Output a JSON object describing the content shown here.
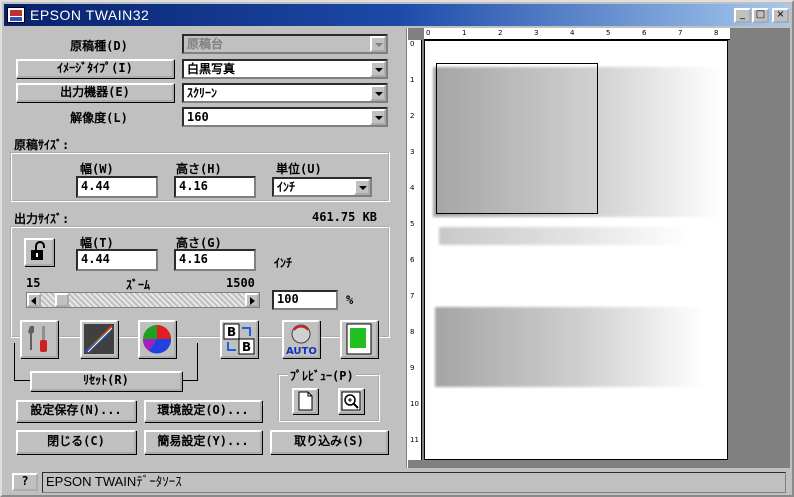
{
  "window": {
    "title": "EPSON TWAIN32",
    "minimize": "_",
    "maximize": "□",
    "close": "×"
  },
  "source_type": {
    "label": "原稿種(D)",
    "value": "原稿台"
  },
  "image_type": {
    "label": "ｲﾒｰｼﾞﾀｲﾌﾟ(I)",
    "value": "白黒写真"
  },
  "output_device": {
    "label": "出力機器(E)",
    "value": "ｽｸﾘｰﾝ"
  },
  "resolution": {
    "label": "解像度(L)",
    "value": "160"
  },
  "source_size": {
    "title": "原稿ｻｲｽﾞ:",
    "width_label": "幅(W)",
    "width_value": "4.44",
    "height_label": "高さ(H)",
    "height_value": "4.16",
    "unit_label": "単位(U)",
    "unit_value": "ｲﾝﾁ"
  },
  "output_size": {
    "title": "出力ｻｲｽﾞ:",
    "file_size": "461.75 KB",
    "width_label": "幅(T)",
    "width_value": "4.44",
    "height_label": "高さ(G)",
    "height_value": "4.16",
    "unit": "ｲﾝﾁ",
    "zoom_min": "15",
    "zoom_label": "ｽﾞｰﾑ",
    "zoom_max": "1500",
    "zoom_value": "100",
    "zoom_unit": "%",
    "zoom_level": 100
  },
  "buttons": {
    "reset": "ﾘｾｯﾄ(R)",
    "save_settings": "設定保存(N)...",
    "environment": "環境設定(O)...",
    "close": "閉じる(C)",
    "simple_settings": "簡易設定(Y)...",
    "scan": "取り込み(S)",
    "auto": "AUTO"
  },
  "preview": {
    "label": "ﾌﾟﾚﾋﾞｭｰ(P)",
    "ruler_top": [
      "0",
      "1",
      "2",
      "3",
      "4",
      "5",
      "6",
      "7",
      "8"
    ],
    "ruler_left": [
      "0",
      "1",
      "2",
      "3",
      "4",
      "5",
      "6",
      "7",
      "8",
      "9",
      "10",
      "11"
    ]
  },
  "status": {
    "help": "?",
    "text": "EPSON TWAINﾃﾞｰﾀｿｰｽ"
  },
  "colors": {
    "title_start": "#08216b",
    "title_end": "#a6caf0",
    "face": "#c0c0c0",
    "preview_bg": "#808080"
  }
}
